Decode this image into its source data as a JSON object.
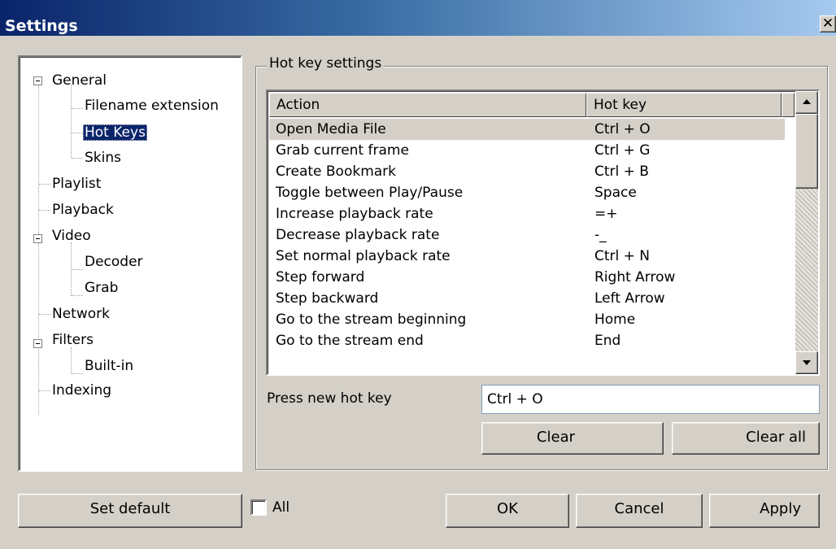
{
  "window": {
    "title": "Settings",
    "close_glyph": "✕"
  },
  "tree": [
    {
      "label": "General",
      "expanded": true
    },
    {
      "label": "Filename extension"
    },
    {
      "label": "Hot Keys",
      "selected": true
    },
    {
      "label": "Skins"
    },
    {
      "label": "Playlist"
    },
    {
      "label": "Playback"
    },
    {
      "label": "Video",
      "expanded": true
    },
    {
      "label": "Decoder"
    },
    {
      "label": "Grab"
    },
    {
      "label": "Network"
    },
    {
      "label": "Filters",
      "expanded": true
    },
    {
      "label": "Built-in"
    },
    {
      "label": "Indexing"
    }
  ],
  "hotkeys": {
    "group_title": "Hot key settings",
    "columns": {
      "action": "Action",
      "hotkey": "Hot key"
    },
    "rows": [
      {
        "action": "Open Media File",
        "key": "Ctrl + O"
      },
      {
        "action": "Grab current frame",
        "key": "Ctrl + G"
      },
      {
        "action": "Create Bookmark",
        "key": "Ctrl + B"
      },
      {
        "action": "Toggle between Play/Pause",
        "key": "Space"
      },
      {
        "action": "Increase playback rate",
        "key": "=+"
      },
      {
        "action": "Decrease playback rate",
        "key": "-_"
      },
      {
        "action": "Set normal playback rate",
        "key": "Ctrl + N"
      },
      {
        "action": "Step forward",
        "key": "Right Arrow"
      },
      {
        "action": "Step backward",
        "key": "Left Arrow"
      },
      {
        "action": "Go to the stream beginning",
        "key": "Home"
      },
      {
        "action": "Go to the stream end",
        "key": "End"
      }
    ],
    "press_label": "Press new hot key",
    "current_value": "Ctrl + O",
    "clear_label": "Clear",
    "clear_all_label": "Clear all"
  },
  "footer": {
    "set_default": "Set default",
    "all_label": "All",
    "ok": "OK",
    "cancel": "Cancel",
    "apply": "Apply"
  },
  "colors": {
    "selection": "#0a246a",
    "face": "#d4d0c8"
  }
}
